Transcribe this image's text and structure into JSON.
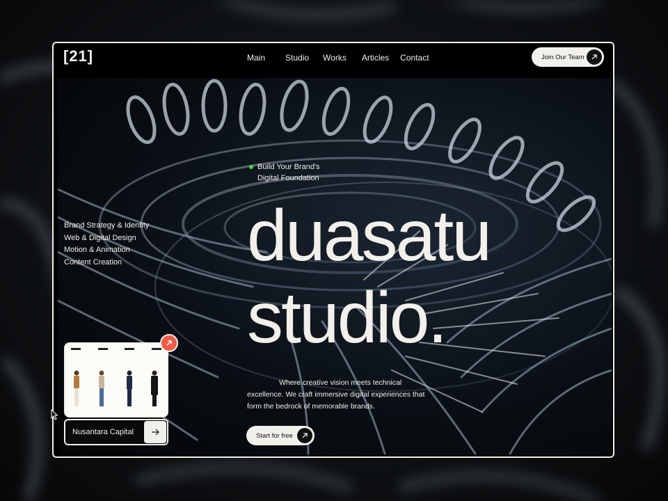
{
  "brand": {
    "logo": "[21]"
  },
  "nav": {
    "items": [
      "Main",
      "Studio",
      "Works",
      "Articles",
      "Contact"
    ]
  },
  "header_cta": {
    "label": "Join Our Team",
    "icon": "arrow-up-right-icon"
  },
  "tagline": {
    "line1": "Build Your Brand's",
    "line2": "Digital Foundation",
    "dot_color": "#3ddc3d"
  },
  "services": [
    "Brand Strategy & Identity",
    "Web & Digital Design",
    "Motion & Animation",
    "Content Creation"
  ],
  "hero": {
    "line1": "duasatu",
    "line2": "studio."
  },
  "description": {
    "line1": "Where creative vision meets technical",
    "line2": "excellence. We craft immersive digital experiences that",
    "line3": "form the bedrock of memorable brands."
  },
  "primary_cta": {
    "label": "Start for free",
    "icon": "arrow-up-right-icon"
  },
  "case_card": {
    "title": "Nusantara Capital",
    "badge_icon": "arrow-up-right-icon",
    "badge_color": "#f05a48",
    "go_icon": "arrow-right-icon"
  },
  "colors": {
    "text": "#f2f0ea",
    "background": "#000000",
    "accent": "#f05a48"
  }
}
